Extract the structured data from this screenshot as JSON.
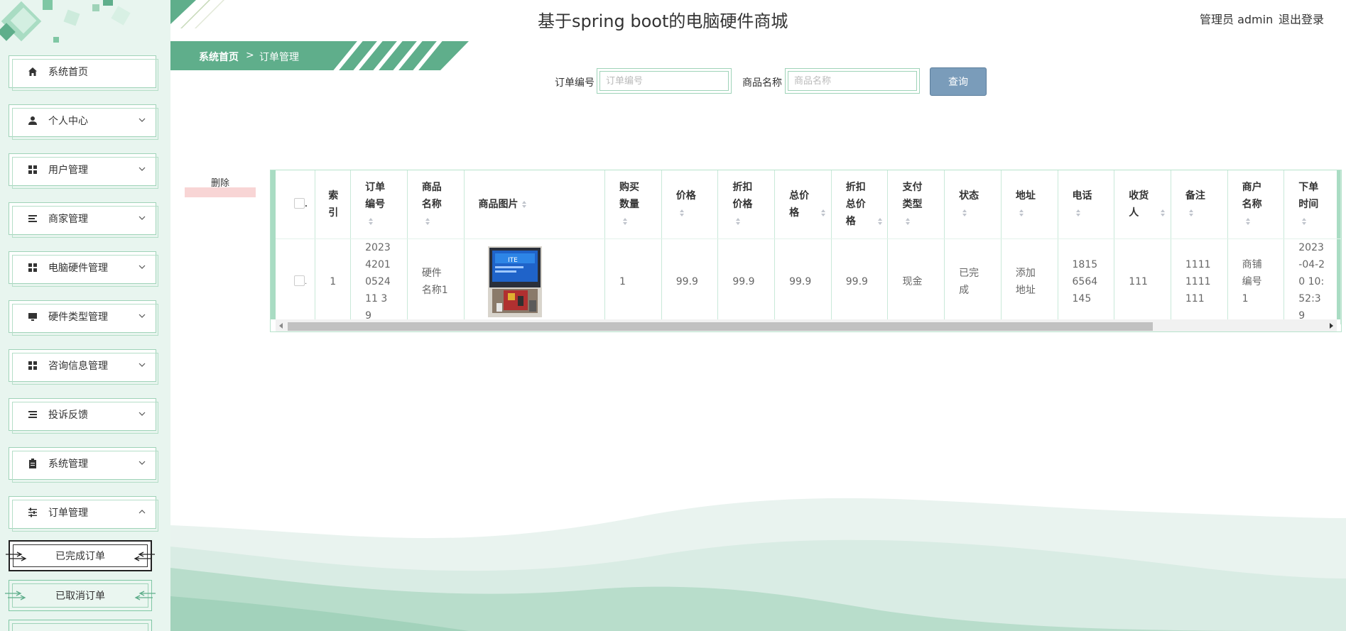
{
  "header": {
    "title": "基于spring boot的电脑硬件商城",
    "user_role": "管理员 admin",
    "logout": "退出登录"
  },
  "breadcrumb": {
    "home": "系统首页",
    "separator": ">",
    "current": "订单管理"
  },
  "sidebar": {
    "items": [
      {
        "label": "系统首页",
        "icon": "home-icon"
      },
      {
        "label": "个人中心",
        "icon": "user-icon"
      },
      {
        "label": "用户管理",
        "icon": "grid-icon"
      },
      {
        "label": "商家管理",
        "icon": "list-icon"
      },
      {
        "label": "电脑硬件管理",
        "icon": "grid-icon"
      },
      {
        "label": "硬件类型管理",
        "icon": "monitor-icon"
      },
      {
        "label": "咨询信息管理",
        "icon": "grid-icon"
      },
      {
        "label": "投诉反馈",
        "icon": "list-icon"
      },
      {
        "label": "系统管理",
        "icon": "clipboard-icon"
      },
      {
        "label": "订单管理",
        "icon": "sliders-icon"
      }
    ],
    "sub_items": [
      {
        "label": "已完成订单",
        "active": true
      },
      {
        "label": "已取消订单",
        "active": false
      }
    ]
  },
  "search": {
    "order_no_label": "订单编号",
    "order_no_placeholder": "订单编号",
    "order_no_value": "",
    "product_name_label": "商品名称",
    "product_name_placeholder": "商品名称",
    "product_name_value": "",
    "query_label": "查询"
  },
  "actions": {
    "delete_label": "删除"
  },
  "table": {
    "columns": [
      "",
      "索引",
      "订单编号",
      "商品名称",
      "商品图片",
      "购买数量",
      "价格",
      "折扣价格",
      "总价格",
      "折扣总价格",
      "支付类型",
      "状态",
      "地址",
      "电话",
      "收货人",
      "备注",
      "商户名称",
      "下单时间"
    ],
    "rows": [
      {
        "index": "1",
        "order_no": "20234201052411 39",
        "product_name": "硬件名称1",
        "image": "product-photo",
        "quantity": "1",
        "price": "99.9",
        "discount_price": "99.9",
        "total_price": "99.9",
        "discount_total_price": "99.9",
        "payment_type": "现金",
        "status": "已完成",
        "address": "添加地址",
        "phone": "18156564145",
        "receiver": "111",
        "remark": "11111111111",
        "merchant": "商铺编号1",
        "order_time": "2023-04-20 10:52:39"
      }
    ]
  },
  "colors": {
    "accent": "#5fae8b",
    "sidebar_bg": "#e8f5ef",
    "query_btn": "#7a9cba",
    "delete_bg": "#f8d5d5"
  }
}
